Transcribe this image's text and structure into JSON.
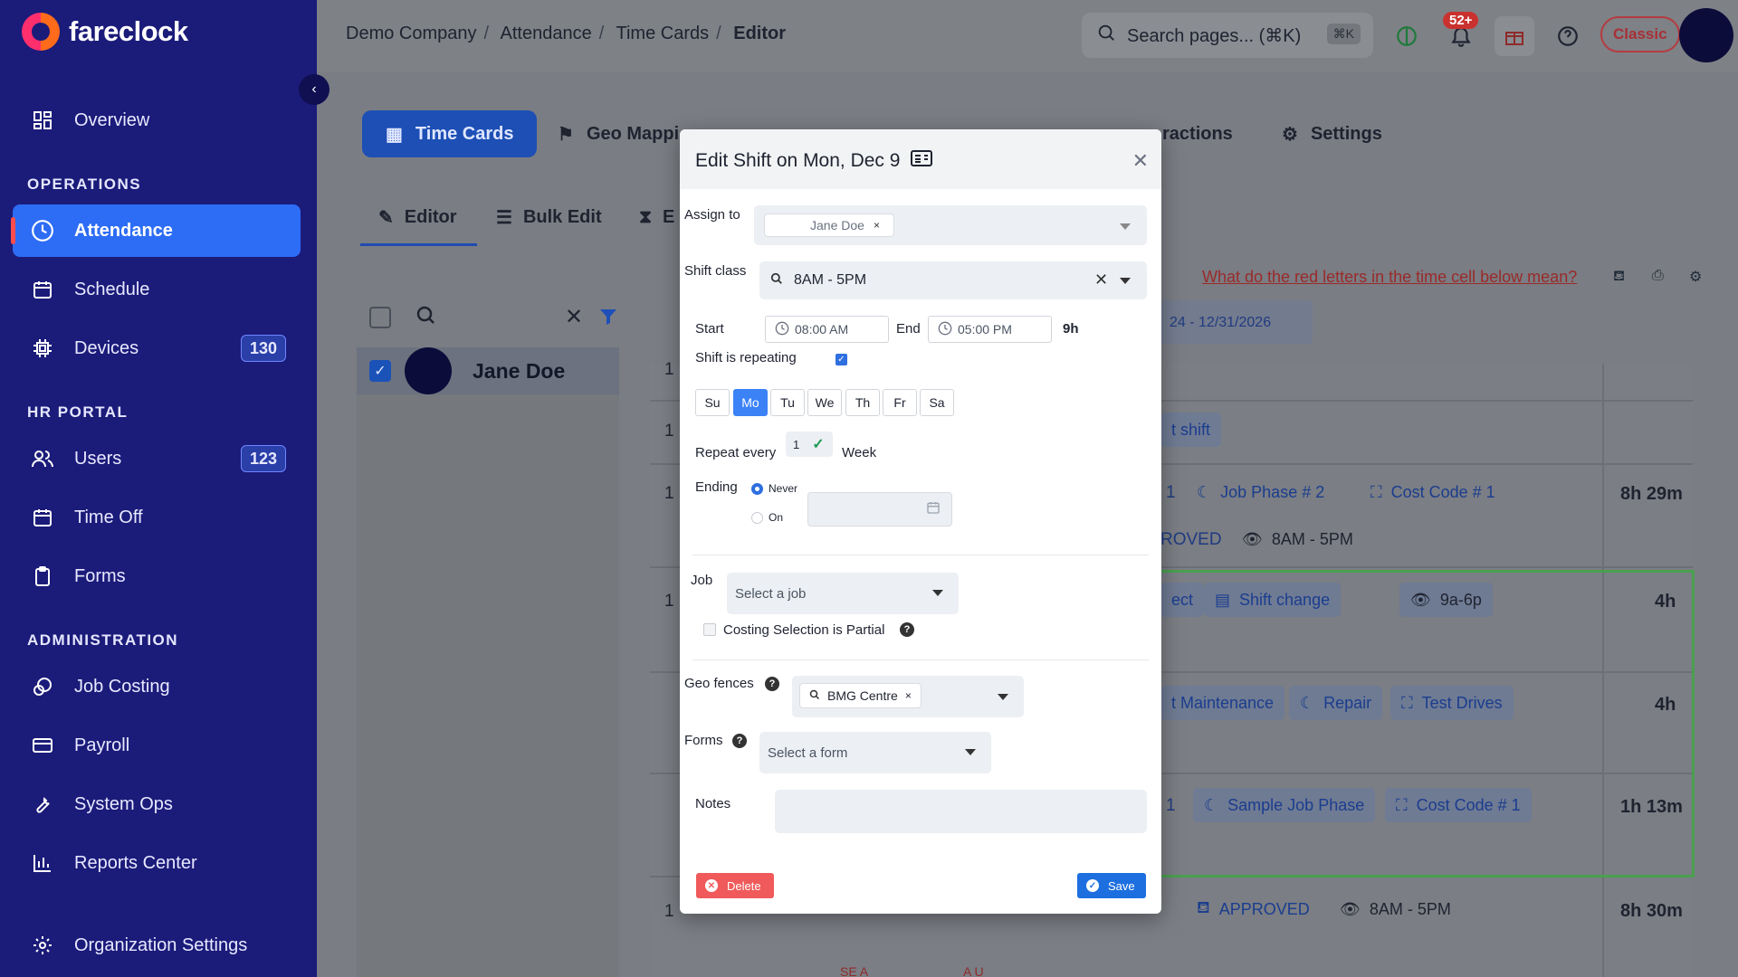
{
  "app": {
    "name": "fareclock"
  },
  "sidebar": {
    "items": [
      {
        "label": "Overview"
      },
      {
        "label": "Attendance"
      },
      {
        "label": "Schedule"
      },
      {
        "label": "Devices",
        "badge": "130"
      },
      {
        "label": "Users",
        "badge": "123"
      },
      {
        "label": "Time Off"
      },
      {
        "label": "Forms"
      },
      {
        "label": "Job Costing"
      },
      {
        "label": "Payroll"
      },
      {
        "label": "System Ops"
      },
      {
        "label": "Reports Center"
      },
      {
        "label": "Organization Settings"
      }
    ],
    "sections": {
      "operations": "OPERATIONS",
      "hr_portal": "HR PORTAL",
      "administration": "ADMINISTRATION"
    }
  },
  "header": {
    "breadcrumbs": [
      "Demo Company",
      "Attendance",
      "Time Cards",
      "Editor"
    ],
    "search_placeholder": "Search pages... (⌘K)",
    "search_shortcut": "⌘K",
    "notification_count": "52+",
    "classic_label": "Classic"
  },
  "tabs": {
    "time_cards": "Time Cards",
    "geo_mapping": "Geo Mappi",
    "interactions": "ractions",
    "settings": "Settings"
  },
  "subtabs": {
    "editor": "Editor",
    "bulk_edit": "Bulk Edit",
    "third": "E"
  },
  "employee": {
    "name": "Jane Doe"
  },
  "background": {
    "red_letters_link": "What do the red letters in the time cell below mean?",
    "date_range": "24 - 12/31/2026",
    "row_nums": [
      "1",
      "1",
      "1",
      "1",
      "1"
    ],
    "chips": {
      "shift": "t shift",
      "job_phase_2": "Job Phase # 2",
      "cost_code_1": "Cost Code # 1",
      "roved": "ROVED",
      "shift_8_5": "8AM - 5PM",
      "ect": "ect",
      "shift_change": "Shift change",
      "shift_9a6p": "9a-6p",
      "maintenance": "t Maintenance",
      "repair": "Repair",
      "test_drives": "Test Drives",
      "sample_job_phase": "Sample Job Phase",
      "cost_code_1b": "Cost Code # 1",
      "approved": "APPROVED",
      "shift_8_5b": "8AM - 5PM",
      "digit_1a": "1",
      "digit_1b": "1"
    },
    "hours": [
      "8h 29m",
      "4h",
      "4h",
      "1h 13m",
      "8h 30m"
    ],
    "bottom_marks": [
      "SE A",
      "A U"
    ]
  },
  "modal": {
    "title": "Edit Shift on Mon, Dec 9",
    "assign_to_label": "Assign to",
    "assignee": "Jane Doe",
    "shift_class_label": "Shift class",
    "shift_class_value": "8AM - 5PM",
    "start_label": "Start",
    "start_value": "08:00 AM",
    "end_label": "End",
    "end_value": "05:00 PM",
    "duration": "9h",
    "repeating_label": "Shift is repeating",
    "days": [
      {
        "label": "Su",
        "on": false
      },
      {
        "label": "Mo",
        "on": true
      },
      {
        "label": "Tu",
        "on": false
      },
      {
        "label": "We",
        "on": false
      },
      {
        "label": "Th",
        "on": false
      },
      {
        "label": "Fr",
        "on": false
      },
      {
        "label": "Sa",
        "on": false
      }
    ],
    "repeat_every_label": "Repeat every",
    "repeat_every_value": "1",
    "repeat_unit": "Week",
    "ending_label": "Ending",
    "ending_never": "Never",
    "ending_on": "On",
    "job_label": "Job",
    "job_placeholder": "Select a job",
    "costing_partial_label": "Costing Selection is Partial",
    "geofences_label": "Geo fences",
    "geofence_value": "BMG Centre",
    "forms_label": "Forms",
    "forms_placeholder": "Select a form",
    "notes_label": "Notes",
    "delete_label": "Delete",
    "save_label": "Save"
  },
  "colors": {
    "sidebar_bg": "#1b1b7a",
    "accent": "#2d6cf5",
    "save": "#1d6fe0",
    "delete": "#f05a5a"
  }
}
